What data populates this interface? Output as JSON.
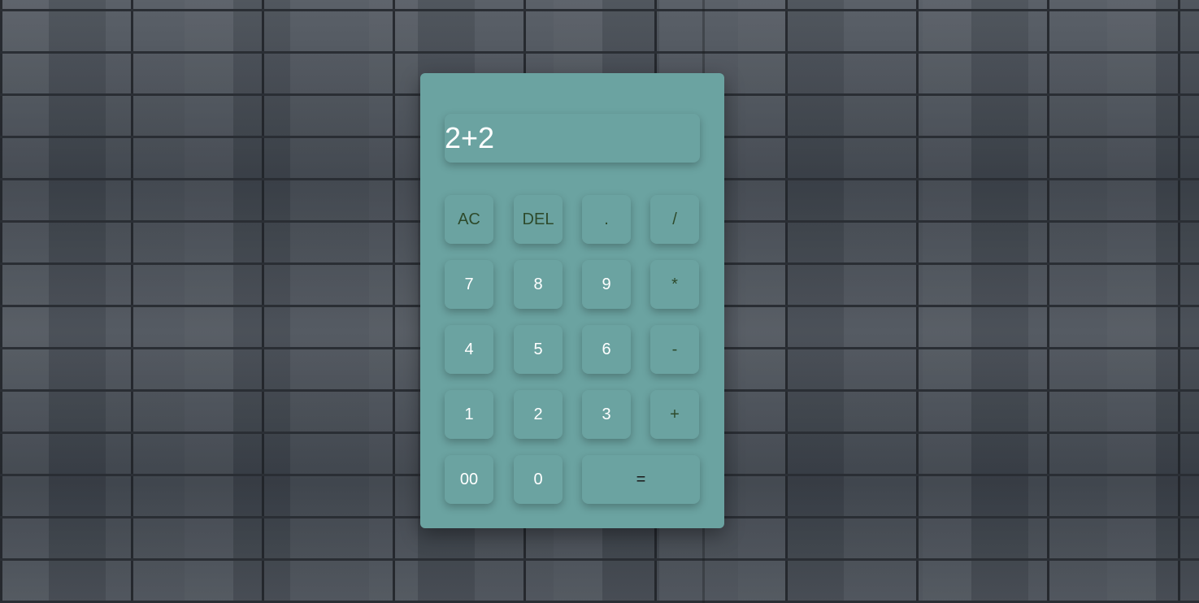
{
  "display": {
    "value": "2+2"
  },
  "keys": {
    "ac": "AC",
    "del": "DEL",
    "dot": ".",
    "divide": "/",
    "seven": "7",
    "eight": "8",
    "nine": "9",
    "multiply": "*",
    "four": "4",
    "five": "5",
    "six": "6",
    "minus": "-",
    "one": "1",
    "two": "2",
    "three": "3",
    "plus": "+",
    "double_zero": "00",
    "zero": "0",
    "equals": "="
  },
  "colors": {
    "calculator_body": "#6ba3a1",
    "digit_text": "#ffffff",
    "operator_text": "#2d4a2b",
    "equals_text": "#1a1a1a"
  }
}
